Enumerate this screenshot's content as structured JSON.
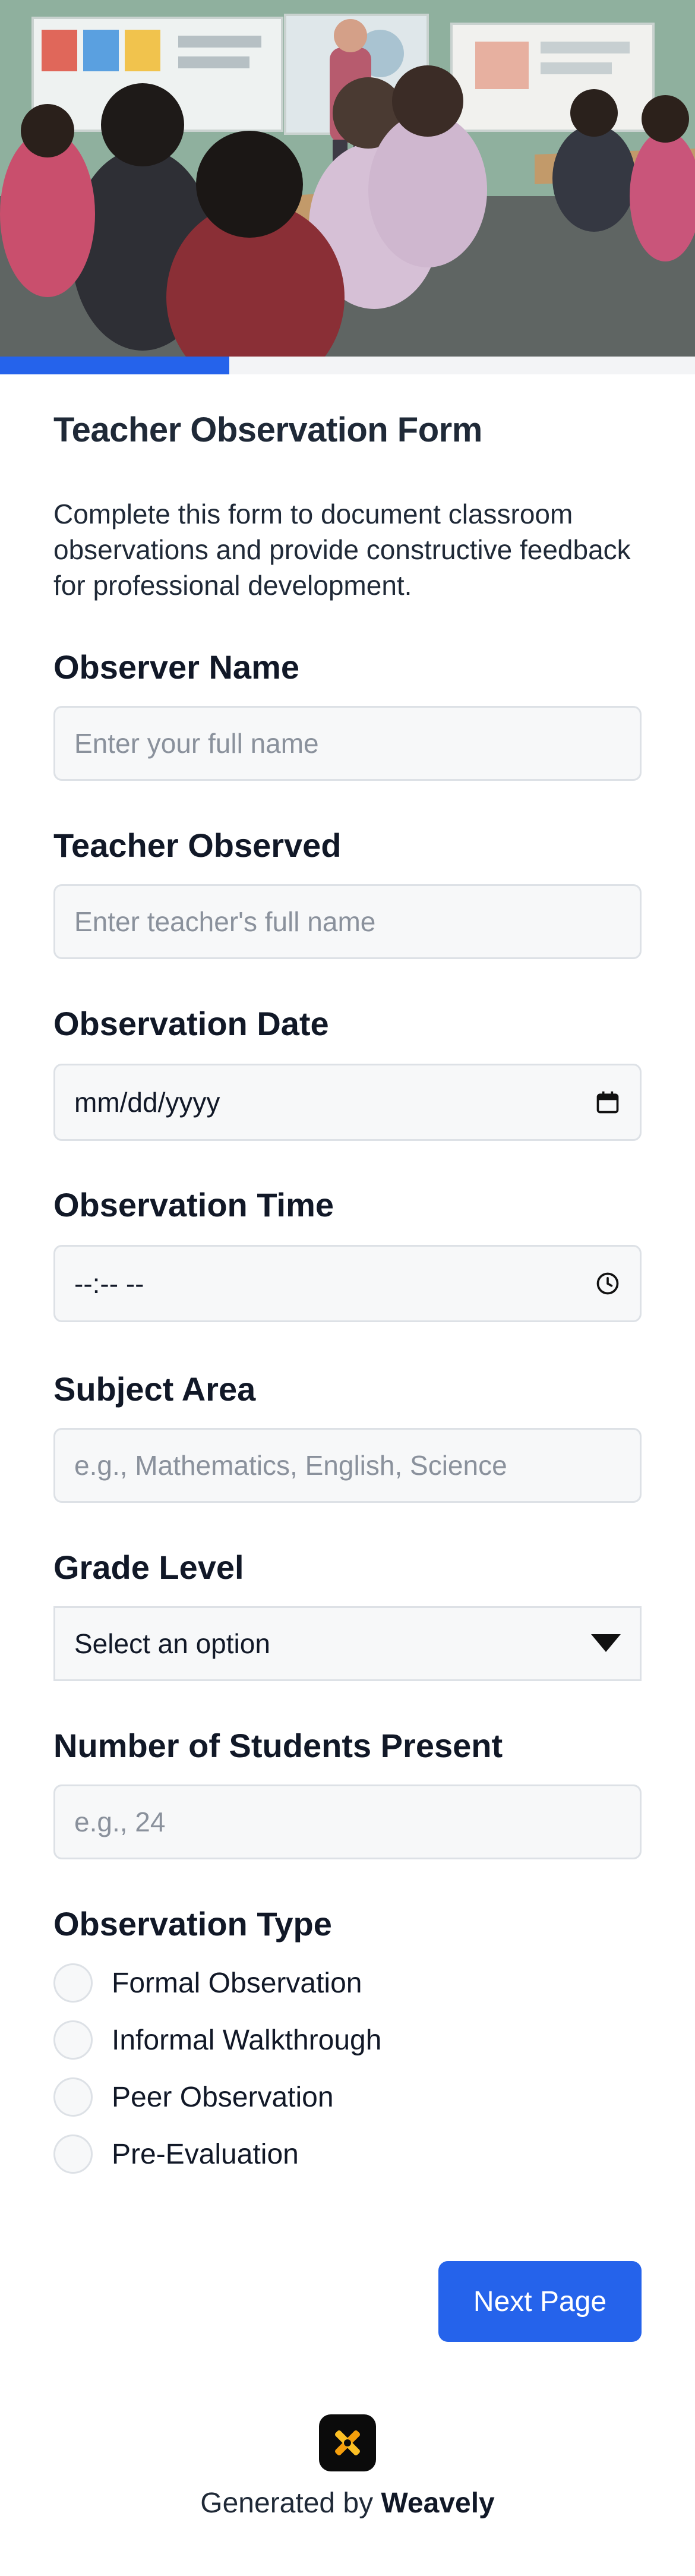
{
  "hero": {
    "image": "classroom-photo"
  },
  "progress": {
    "percent": 33
  },
  "form": {
    "title": "Teacher Observation Form",
    "description": "Complete this form to document classroom observations and provide constructive feedback for professional development.",
    "fields": {
      "observer_name": {
        "label": "Observer Name",
        "placeholder": "Enter your full name"
      },
      "teacher_observed": {
        "label": "Teacher Observed",
        "placeholder": "Enter teacher's full name"
      },
      "observation_date": {
        "label": "Observation Date",
        "value": "mm/dd/yyyy",
        "icon": "calendar-icon"
      },
      "observation_time": {
        "label": "Observation Time",
        "value": "--:-- --",
        "icon": "clock-icon"
      },
      "subject_area": {
        "label": "Subject Area",
        "placeholder": "e.g., Mathematics, English, Science"
      },
      "grade_level": {
        "label": "Grade Level",
        "selected": "Select an option",
        "icon": "caret-down-icon"
      },
      "students_present": {
        "label": "Number of Students Present",
        "placeholder": "e.g., 24"
      },
      "observation_type": {
        "label": "Observation Type",
        "options": [
          "Formal Observation",
          "Informal Walkthrough",
          "Peer Observation",
          "Pre-Evaluation"
        ]
      }
    },
    "next_label": "Next Page"
  },
  "footer": {
    "prefix": "Generated by ",
    "brand": "Weavely",
    "logo": "weavely-logo"
  },
  "colors": {
    "accent": "#2563eb",
    "input_bg": "#f7f8f9",
    "input_border": "#dde1e6",
    "placeholder": "#8a919c"
  }
}
